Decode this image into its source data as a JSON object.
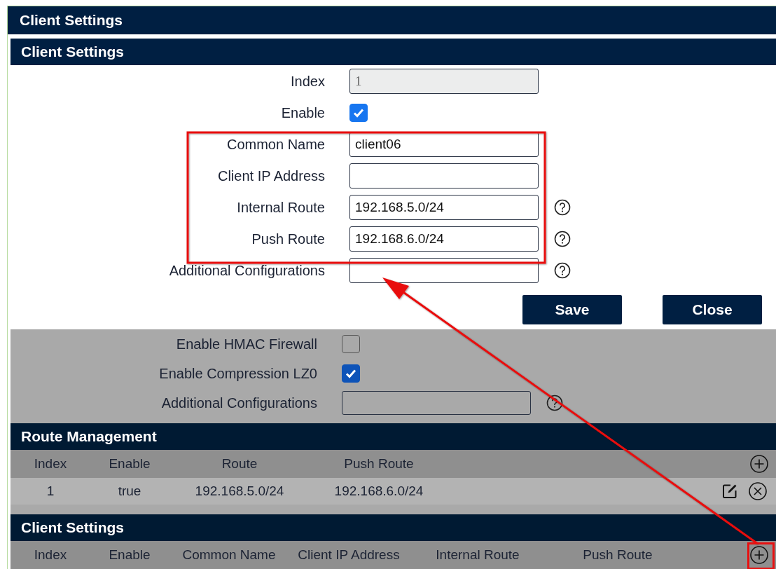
{
  "page_header": {
    "title": "Client Settings"
  },
  "dialog": {
    "title": "Client Settings",
    "fields": [
      {
        "kind": "text",
        "label": "Index",
        "value": "1",
        "disabled": true,
        "help": false
      },
      {
        "kind": "checkbox",
        "label": "Enable",
        "checked": true,
        "help": false
      },
      {
        "kind": "text",
        "label": "Common Name",
        "value": "client06",
        "disabled": false,
        "help": false
      },
      {
        "kind": "text",
        "label": "Client IP Address",
        "disabled": false,
        "help": false
      },
      {
        "kind": "text",
        "label": "Internal Route",
        "value": "192.168.5.0/24",
        "disabled": false,
        "help": true
      },
      {
        "kind": "text",
        "label": "Push Route",
        "value": "192.168.6.0/24",
        "disabled": false,
        "help": true
      },
      {
        "kind": "text",
        "label": "Additional Configurations",
        "disabled": false,
        "help": true
      }
    ],
    "buttons": [
      "Save",
      "Close"
    ]
  },
  "background_form": {
    "fields": [
      {
        "kind": "checkbox",
        "label": "Enable HMAC Firewall",
        "checked": false,
        "help": false
      },
      {
        "kind": "checkbox",
        "label": "Enable Compression LZ0",
        "checked": true,
        "help": false
      },
      {
        "kind": "text",
        "label": "Additional Configurations",
        "disabled": false,
        "help": true
      }
    ]
  },
  "route_management": {
    "title": "Route Management",
    "columns": [
      "Index",
      "Enable",
      "Route",
      "Push Route"
    ],
    "rows": [
      {
        "cells": [
          "1",
          "true",
          "192.168.5.0/24",
          "192.168.6.0/24"
        ]
      }
    ]
  },
  "client_table": {
    "title": "Client Settings",
    "columns": [
      "Index",
      "Enable",
      "Common Name",
      "Client IP Address",
      "Internal Route",
      "Push Route"
    ]
  }
}
